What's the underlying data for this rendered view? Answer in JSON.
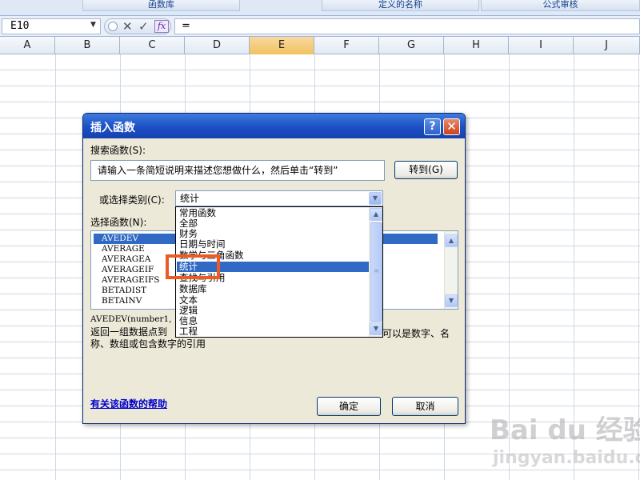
{
  "ribbon": {
    "groups": [
      "函数库",
      "定义的名称",
      "公式审核"
    ]
  },
  "formula_bar": {
    "name_box": "E10",
    "fx_label": "fx",
    "formula": "="
  },
  "columns": [
    "A",
    "B",
    "C",
    "D",
    "E",
    "F",
    "G",
    "H",
    "I",
    "J"
  ],
  "active_column": "E",
  "dialog": {
    "title": "插入函数",
    "help_symbol": "?",
    "close_symbol": "✕",
    "search_label": "搜索函数(S):",
    "search_value": "请输入一条简短说明来描述您想做什么，然后单击“转到”",
    "goto_button": "转到(G)",
    "category_label": "或选择类别(C):",
    "category_value": "统计",
    "function_label": "选择函数(N):",
    "functions": [
      "AVEDEV",
      "AVERAGE",
      "AVERAGEA",
      "AVERAGEIF",
      "AVERAGEIFS",
      "BETADIST",
      "BETAINV"
    ],
    "selected_function": "AVEDEV",
    "syntax": "AVEDEV(number1,",
    "description_line1": "返回一组数据点到",
    "description_line1_end": "可以是数字、名",
    "description_line2": "称、数组或包含数字的引用",
    "help_link": "有关该函数的帮助",
    "ok_button": "确定",
    "cancel_button": "取消"
  },
  "category_dropdown": {
    "items": [
      "常用函数",
      "全部",
      "财务",
      "日期与时间",
      "数学与三角函数",
      "统计",
      "查找与引用",
      "数据库",
      "文本",
      "逻辑",
      "信息",
      "工程"
    ],
    "selected": "统计"
  },
  "watermark": {
    "brand": "Bai du 经验",
    "url": "jingyan.baidu.com"
  },
  "colors": {
    "titlebar": "#1b4fc4",
    "selection": "#316ac5",
    "highlight_box": "#ee5a24",
    "active_column": "#f1c15f"
  }
}
